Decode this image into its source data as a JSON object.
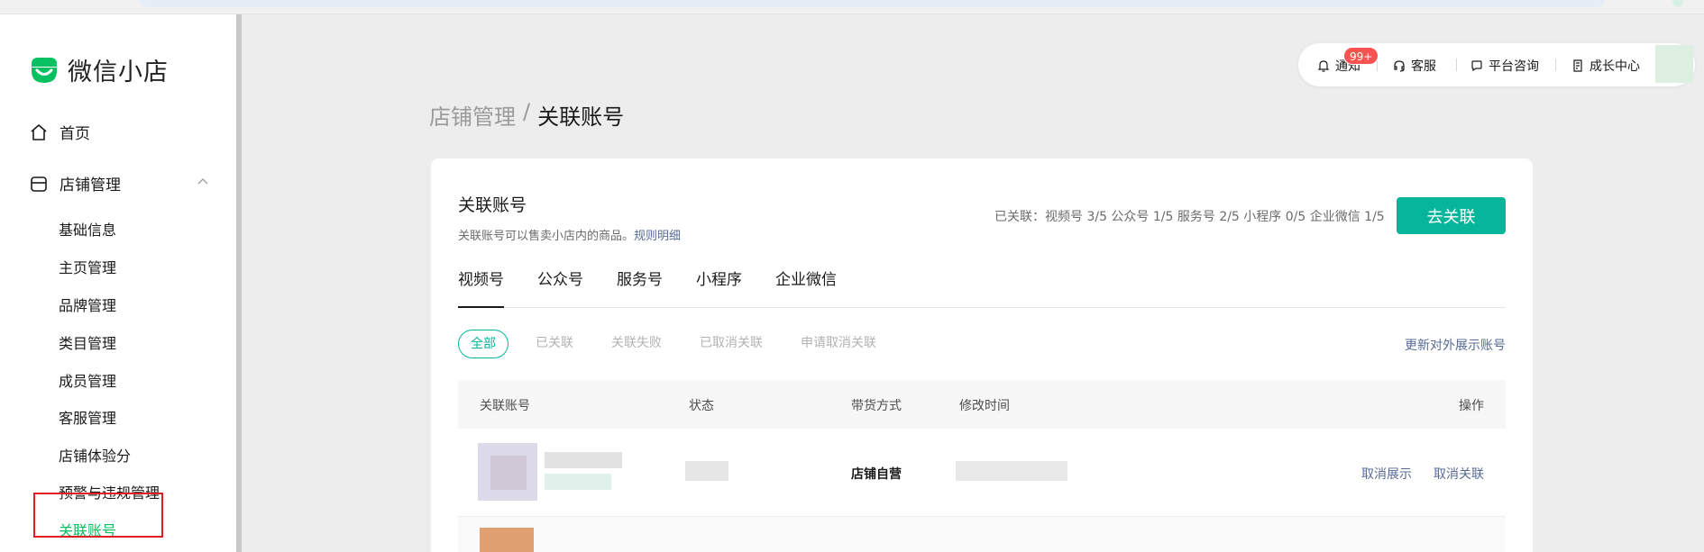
{
  "brand": {
    "name": "微信小店",
    "color": "#07c160"
  },
  "sidebar": {
    "home": {
      "label": "首页",
      "icon": "home-icon"
    },
    "store": {
      "label": "店铺管理",
      "icon": "store-icon",
      "items": [
        {
          "label": "基础信息"
        },
        {
          "label": "主页管理"
        },
        {
          "label": "品牌管理"
        },
        {
          "label": "类目管理"
        },
        {
          "label": "成员管理"
        },
        {
          "label": "客服管理"
        },
        {
          "label": "店铺体验分"
        },
        {
          "label": "预警与违规管理"
        },
        {
          "label": "关联账号"
        }
      ]
    }
  },
  "toolbar": {
    "notify": "通知",
    "badge": "99+",
    "service": "客服",
    "consult": "平台咨询",
    "growth": "成长中心"
  },
  "breadcrumb": {
    "parent": "店铺管理",
    "separator": "/",
    "current": "关联账号"
  },
  "card": {
    "title": "关联账号",
    "desc": "关联账号可以售卖小店内的商品。",
    "rule_link": "规则明细",
    "stats": "已关联：视频号 3/5 公众号 1/5 服务号 2/5 小程序 0/5 企业微信 1/5",
    "go_button": "去关联"
  },
  "tabs": [
    "视频号",
    "公众号",
    "服务号",
    "小程序",
    "企业微信"
  ],
  "filters": [
    "全部",
    "已关联",
    "关联失败",
    "已取消关联",
    "申请取消关联"
  ],
  "update_link": "更新对外展示账号",
  "table": {
    "headers": {
      "account": "关联账号",
      "status": "状态",
      "mode": "带货方式",
      "time": "修改时间",
      "ops": "操作"
    },
    "rows": [
      {
        "mode": "店铺自营",
        "op1": "取消展示",
        "op2": "取消关联"
      }
    ]
  },
  "colors": {
    "accent": "#07b59a",
    "link": "#576b95",
    "badge": "#fa5151"
  }
}
